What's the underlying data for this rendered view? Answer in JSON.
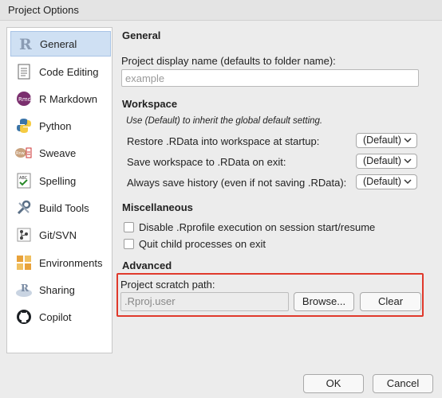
{
  "window": {
    "title": "Project Options"
  },
  "sidebar": {
    "items": [
      {
        "label": "General",
        "icon": "r-logo-icon",
        "selected": true
      },
      {
        "label": "Code Editing",
        "icon": "document-icon"
      },
      {
        "label": "R Markdown",
        "icon": "rmd-icon"
      },
      {
        "label": "Python",
        "icon": "python-icon"
      },
      {
        "label": "Sweave",
        "icon": "sweave-icon"
      },
      {
        "label": "Spelling",
        "icon": "abc-check-icon"
      },
      {
        "label": "Build Tools",
        "icon": "wrench-icon"
      },
      {
        "label": "Git/SVN",
        "icon": "git-icon"
      },
      {
        "label": "Environments",
        "icon": "environments-icon"
      },
      {
        "label": "Sharing",
        "icon": "sharing-icon"
      },
      {
        "label": "Copilot",
        "icon": "github-icon"
      }
    ]
  },
  "general": {
    "heading": "General",
    "display_name_label": "Project display name (defaults to folder name):",
    "display_name_placeholder": "example"
  },
  "workspace": {
    "heading": "Workspace",
    "note": "Use (Default) to inherit the global default setting.",
    "rows": [
      {
        "label": "Restore .RData into workspace at startup:",
        "value": "(Default)"
      },
      {
        "label": "Save workspace to .RData on exit:",
        "value": "(Default)"
      },
      {
        "label": "Always save history (even if not saving .RData):",
        "value": "(Default)"
      }
    ]
  },
  "misc": {
    "heading": "Miscellaneous",
    "checkboxes": [
      {
        "label": "Disable .Rprofile execution on session start/resume",
        "checked": false
      },
      {
        "label": "Quit child processes on exit",
        "checked": false
      }
    ]
  },
  "advanced": {
    "heading": "Advanced",
    "scratch_label": "Project scratch path:",
    "scratch_value": ".Rproj.user",
    "browse_label": "Browse...",
    "clear_label": "Clear"
  },
  "footer": {
    "ok_label": "OK",
    "cancel_label": "Cancel"
  },
  "colors": {
    "highlight": "#e0392b",
    "selected_bg": "#cfe0f3"
  }
}
